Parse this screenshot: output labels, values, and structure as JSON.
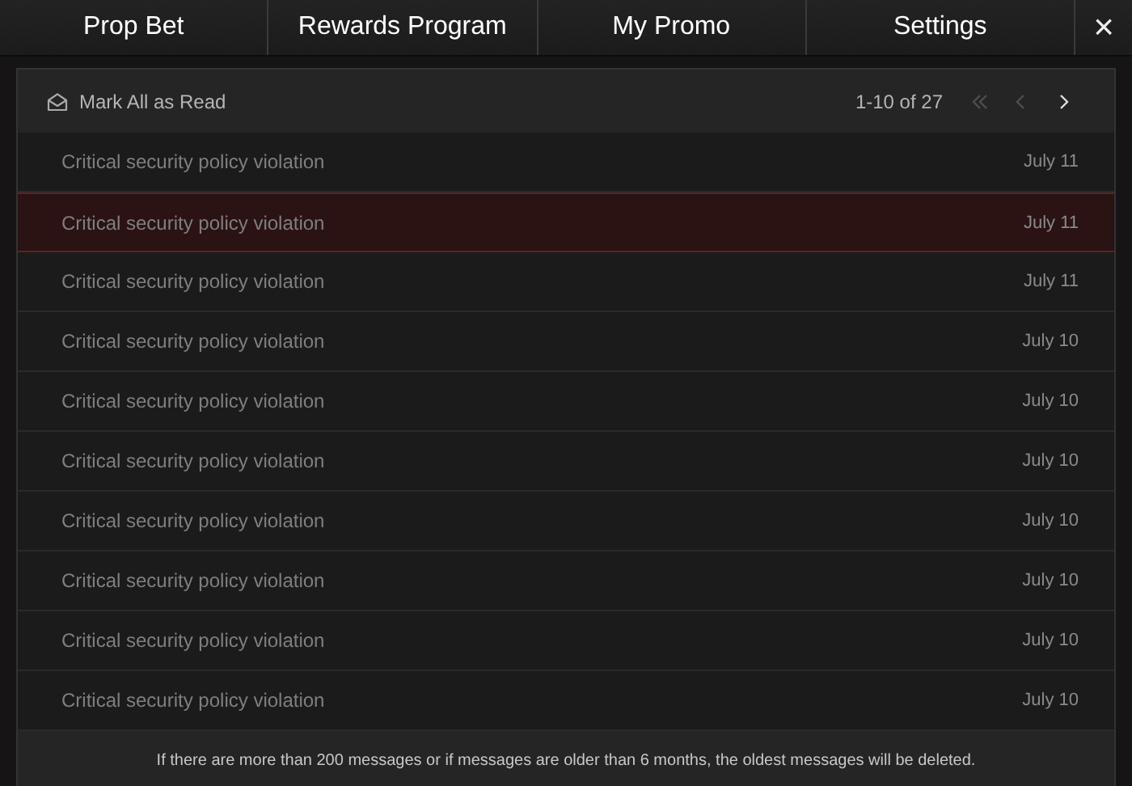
{
  "tabs": [
    {
      "label": "Prop Bet",
      "selected": false
    },
    {
      "label": "Rewards Program",
      "selected": false
    },
    {
      "label": "My Promo",
      "selected": false
    },
    {
      "label": "Settings",
      "selected": false
    }
  ],
  "close_button": {
    "label": "×"
  },
  "toolbar": {
    "mark_all": "Mark All as Read",
    "range": "1-10 of 27",
    "pager": [
      {
        "kind": "first",
        "disabled": true
      },
      {
        "kind": "prev",
        "disabled": true
      },
      {
        "kind": "next",
        "disabled": false
      }
    ]
  },
  "messages": [
    {
      "subject": "Critical security policy violation",
      "date": "July 11",
      "selected": false
    },
    {
      "subject": "Critical security policy violation",
      "date": "July 11",
      "selected": true
    },
    {
      "subject": "Critical security policy violation",
      "date": "July 11",
      "selected": false
    },
    {
      "subject": "Critical security policy violation",
      "date": "July 10",
      "selected": false
    },
    {
      "subject": "Critical security policy violation",
      "date": "July 10",
      "selected": false
    },
    {
      "subject": "Critical security policy violation",
      "date": "July 10",
      "selected": false
    },
    {
      "subject": "Critical security policy violation",
      "date": "July 10",
      "selected": false
    },
    {
      "subject": "Critical security policy violation",
      "date": "July 10",
      "selected": false
    },
    {
      "subject": "Critical security policy violation",
      "date": "July 10",
      "selected": false
    },
    {
      "subject": "Critical security policy violation",
      "date": "July 10",
      "selected": false
    }
  ],
  "footer_note": "If there are more than 200 messages or if messages are older than 6 months, the oldest messages will be deleted."
}
